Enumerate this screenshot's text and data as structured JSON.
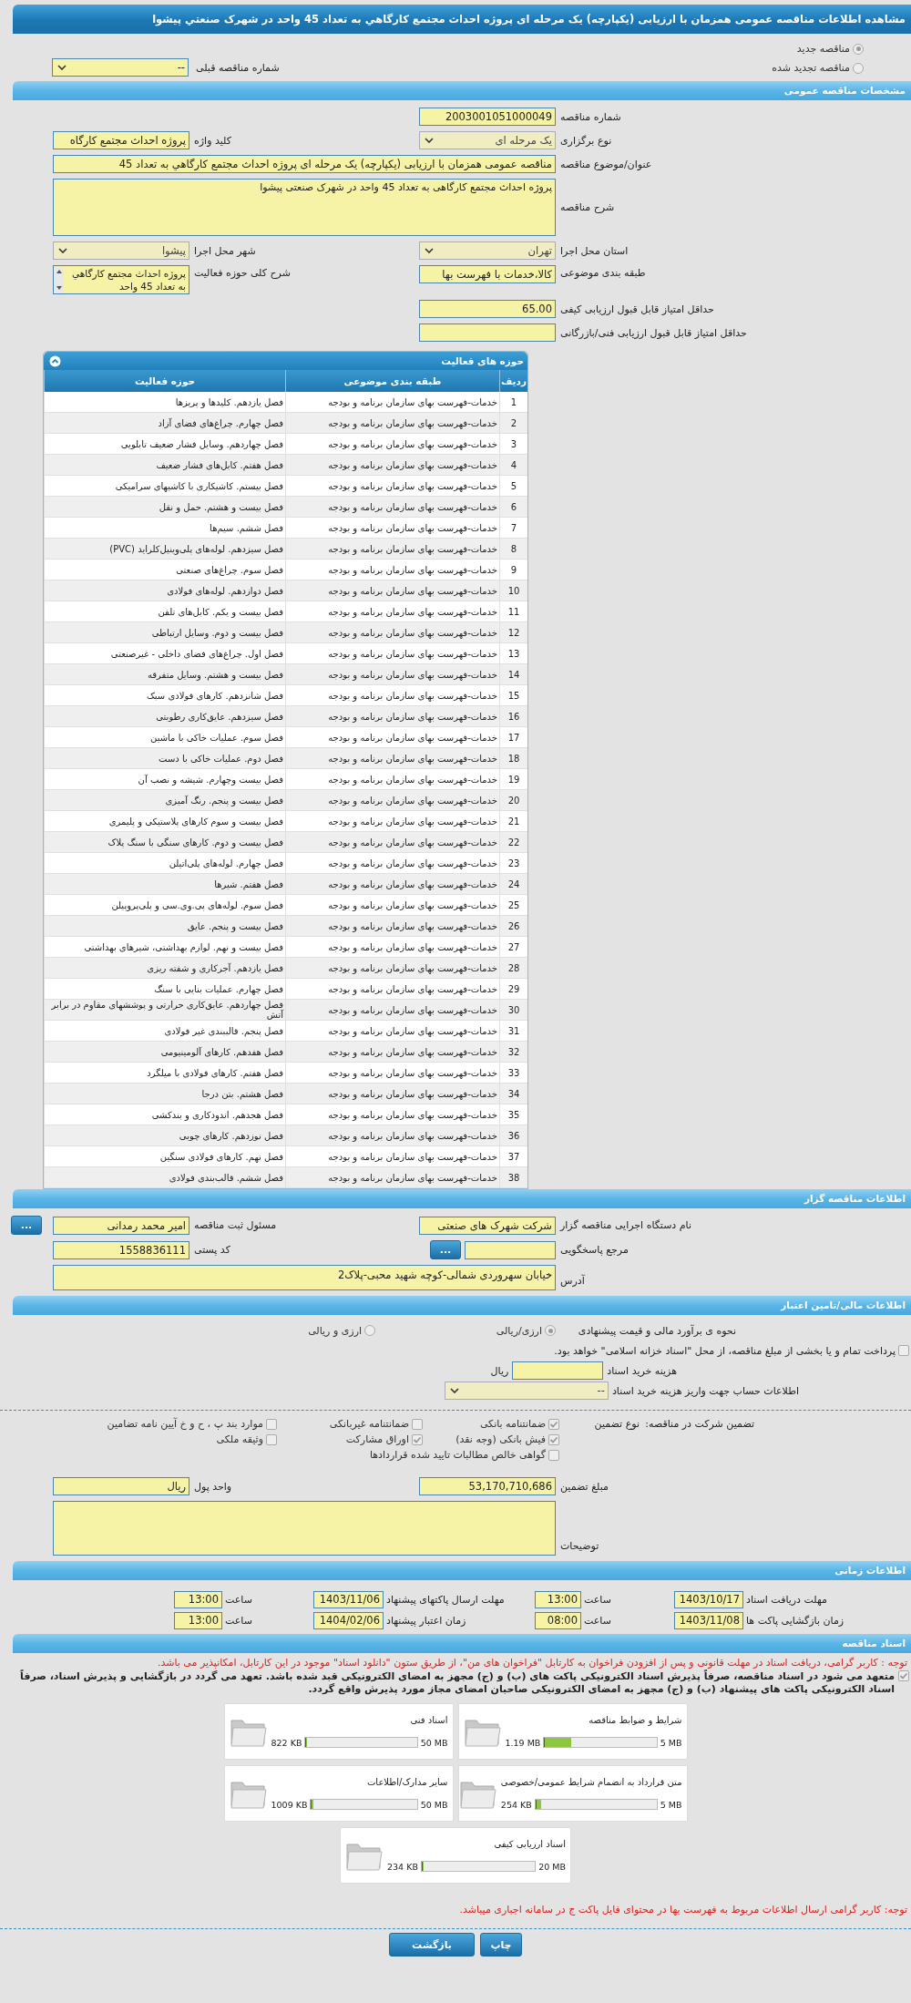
{
  "page_title": "مشاهده اطلاعات مناقصه عمومی همزمان با ارزیابی (یکپارچه) یک مرحله ای پروژه احداث مجتمع کارگاهي به تعداد 45 واحد در شهرک صنعتي پيشوا",
  "tender_types": [
    {
      "label": "مناقصه جدید",
      "selected": true
    },
    {
      "label": "مناقصه تجدید شده",
      "selected": false
    }
  ],
  "previous_tender": {
    "label": "شماره مناقصه قبلی",
    "value": "--"
  },
  "general": {
    "title": "مشخصات مناقصه عمومی",
    "tender_number": {
      "label": "شماره مناقصه",
      "value": "2003001051000049"
    },
    "holding_type": {
      "label": "نوع برگزاری",
      "value": "یک مرحله ای"
    },
    "keyword": {
      "label": "کلید واژه",
      "value": "پروژه احداث مجتمع کارگاه"
    },
    "subject": {
      "label": "عنوان/موضوع مناقصه",
      "value": "مناقصه عمومی همزمان با ارزیابی (یکپارچه) یک مرحله ای پروژه احداث مجتمع کارگاهي به تعداد 45"
    },
    "description": {
      "label": "شرح مناقصه",
      "value": "پروژه احداث مجتمع کارگاهی به تعداد 45 واحد در شهرک صنعتی پیشوا"
    },
    "province": {
      "label": "استان محل اجرا",
      "value": "تهران"
    },
    "city": {
      "label": "شهر محل اجرا",
      "value": "پیشوا"
    },
    "category": {
      "label": "طبقه بندی موضوعی",
      "value": "کالا،خدمات با فهرست بها"
    },
    "activity_summary": {
      "label": "شرح کلی حوزه فعالیت",
      "value": "پروژه احداث مجتمع کارگاهي به تعداد 45 واحد"
    },
    "min_quality_score": {
      "label": "حداقل امتیاز قابل قبول ارزیابی کیفی",
      "value": "65.00"
    },
    "min_technical_score": {
      "label": "حداقل امتیاز قابل قبول ارزیابی فنی/بازرگانی"
    }
  },
  "activity_table": {
    "title": "حوزه های فعالیت",
    "columns": [
      "ردیف",
      "طبقه بندی موضوعی",
      "حوزه فعالیت"
    ],
    "rows": [
      [
        "1",
        "خدمات-فهرست بهای سازمان برنامه و بودجه",
        "فصل یازدهم. کلیدها و پریزها"
      ],
      [
        "2",
        "خدمات-فهرست بهای سازمان برنامه و بودجه",
        "فصل چهارم. چراغ‌های فضای آزاد"
      ],
      [
        "3",
        "خدمات-فهرست بهای سازمان برنامه و بودجه",
        "فصل چهاردهم. وسایل فشار ضعیف تابلویی"
      ],
      [
        "4",
        "خدمات-فهرست بهای سازمان برنامه و بودجه",
        "فصل هفتم. کابل‌های فشار ضعیف"
      ],
      [
        "5",
        "خدمات-فهرست بهای سازمان برنامه و بودجه",
        "فصل بیستم. کاشیکاری با کاشیهای سرامیکی"
      ],
      [
        "6",
        "خدمات-فهرست بهای سازمان برنامه و بودجه",
        "فصل بیست و هشتم. حمل و نقل"
      ],
      [
        "7",
        "خدمات-فهرست بهای سازمان برنامه و بودجه",
        "فصل ششم. سیم‌ها"
      ],
      [
        "8",
        "خدمات-فهرست بهای سازمان برنامه و بودجه",
        "فصل سیزدهم. لوله‌های پلی‌وینیل‌کلراید (PVC)"
      ],
      [
        "9",
        "خدمات-فهرست بهای سازمان برنامه و بودجه",
        "فصل سوم. چراغ‌های صنعتی"
      ],
      [
        "10",
        "خدمات-فهرست بهای سازمان برنامه و بودجه",
        "فصل دوازدهم. لوله‌های فولادی"
      ],
      [
        "11",
        "خدمات-فهرست بهای سازمان برنامه و بودجه",
        "فصل بیست و یکم. کابل‌های تلفن"
      ],
      [
        "12",
        "خدمات-فهرست بهای سازمان برنامه و بودجه",
        "فصل بیست و دوم. وسایل ارتباطی"
      ],
      [
        "13",
        "خدمات-فهرست بهای سازمان برنامه و بودجه",
        "فصل اول. چراغ‌های فضای داخلی - غیرصنعتی"
      ],
      [
        "14",
        "خدمات-فهرست بهای سازمان برنامه و بودجه",
        "فصل بیست و هشتم. وسایل متفرقه"
      ],
      [
        "15",
        "خدمات-فهرست بهای سازمان برنامه و بودجه",
        "فصل شانزدهم. کارهای فولادی سبک"
      ],
      [
        "16",
        "خدمات-فهرست بهای سازمان برنامه و بودجه",
        "فصل سیزدهم. عایق‌کاری رطوبتی"
      ],
      [
        "17",
        "خدمات-فهرست بهای سازمان برنامه و بودجه",
        "فصل سوم. عملیات خاکی با ماشین"
      ],
      [
        "18",
        "خدمات-فهرست بهای سازمان برنامه و بودجه",
        "فصل دوم. عملیات خاکی با دست"
      ],
      [
        "19",
        "خدمات-فهرست بهای سازمان برنامه و بودجه",
        "فصل بیست وچهارم. شیشه و نصب آن"
      ],
      [
        "20",
        "خدمات-فهرست بهای سازمان برنامه و بودجه",
        "فصل بیست و پنجم. رنگ آمیزی"
      ],
      [
        "21",
        "خدمات-فهرست بهای سازمان برنامه و بودجه",
        "فصل بیست و سوم کارهای پلاستیکی و پلیمری"
      ],
      [
        "22",
        "خدمات-فهرست بهای سازمان برنامه و بودجه",
        "فصل بیست و دوم. کارهای سنگی با سنگ پلاک"
      ],
      [
        "23",
        "خدمات-فهرست بهای سازمان برنامه و بودجه",
        "فصل چهارم. لوله‌های پلی‌اتیلن"
      ],
      [
        "24",
        "خدمات-فهرست بهای سازمان برنامه و بودجه",
        "فصل هفتم. شیرها"
      ],
      [
        "25",
        "خدمات-فهرست بهای سازمان برنامه و بودجه",
        "فصل سوم. لوله‌های پی.وی.سی و پلی‌پروپیلن"
      ],
      [
        "26",
        "خدمات-فهرست بهای سازمان برنامه و بودجه",
        "فصل بیست و پنجم. عایق"
      ],
      [
        "27",
        "خدمات-فهرست بهای سازمان برنامه و بودجه",
        "فصل بیست و نهم. لوازم بهداشتی، شیرهای بهداشتی"
      ],
      [
        "28",
        "خدمات-فهرست بهای سازمان برنامه و بودجه",
        "فصل یازدهم. آجرکاری و شفته ریزی"
      ],
      [
        "29",
        "خدمات-فهرست بهای سازمان برنامه و بودجه",
        "فصل چهارم. عملیات بنایی با سنگ"
      ],
      [
        "30",
        "خدمات-فهرست بهای سازمان برنامه و بودجه",
        "فصل چهاردهم. عایق‌کاری حرارتی و پوششهای مقاوم در برابر آتش"
      ],
      [
        "31",
        "خدمات-فهرست بهای سازمان برنامه و بودجه",
        "فصل پنجم. قالببندی غیر فولادی"
      ],
      [
        "32",
        "خدمات-فهرست بهای سازمان برنامه و بودجه",
        "فصل هفدهم. کارهای آلومینیومی"
      ],
      [
        "33",
        "خدمات-فهرست بهای سازمان برنامه و بودجه",
        "فصل هفتم. کارهای فولادی با میلگرد"
      ],
      [
        "34",
        "خدمات-فهرست بهای سازمان برنامه و بودجه",
        "فصل هشتم. بتن درجا"
      ],
      [
        "35",
        "خدمات-فهرست بهای سازمان برنامه و بودجه",
        "فصل هجدهم. اندودکاری و بندکشی"
      ],
      [
        "36",
        "خدمات-فهرست بهای سازمان برنامه و بودجه",
        "فصل نوزدهم. کارهای چوبی"
      ],
      [
        "37",
        "خدمات-فهرست بهای سازمان برنامه و بودجه",
        "فصل نهم. کارهای فولادی سنگین"
      ],
      [
        "38",
        "خدمات-فهرست بهای سازمان برنامه و بودجه",
        "فصل ششم. قالب‌بندی فولادی"
      ]
    ]
  },
  "organizer": {
    "title": "اطلاعات مناقصه گزار",
    "agency": {
      "label": "نام دستگاه اجرایی مناقصه گزار",
      "value": "شرکت شهرک های صنعتی"
    },
    "registrar": {
      "label": "مسئول ثبت مناقصه",
      "value": "امیر محمد  رمدانی",
      "button": "..."
    },
    "reference": {
      "label": "مرجع پاسخگویی",
      "button": "..."
    },
    "postal_code": {
      "label": "کد پستی",
      "value": "1558836111"
    },
    "address": {
      "label": "آدرس",
      "value": "خیابان سهروردی شمالی-کوچه شهید محبی-پلاک2"
    }
  },
  "finance": {
    "title": "اطلاعات مالی/تامین اعتبار",
    "estimate_label": "نحوه ی برآورد مالی و قیمت پیشنهادی",
    "estimate_options": [
      {
        "label": "ارزی/ریالی",
        "selected": true
      },
      {
        "label": "ارزی و ریالی",
        "selected": false
      }
    ],
    "treasury": {
      "label": "پرداخت تمام و یا بخشی از مبلغ مناقصه، از محل \"اسناد خزانه اسلامی\" خواهد بود.",
      "checked": false
    },
    "doc_fee": {
      "label": "هزینه خرید اسناد",
      "unit": "ریال"
    },
    "account": {
      "label": "اطلاعات حساب جهت واریز هزینه خرید اسناد",
      "value": "--"
    },
    "guarantee_label": "تضمین شرکت در مناقصه:",
    "guarantee_type_label": "نوع تضمین",
    "guarantee_types": [
      {
        "label": "ضمانتنامه بانکی",
        "checked": true
      },
      {
        "label": "ضمانتنامه غیربانکی",
        "checked": false
      },
      {
        "label": "موارد بند پ ، ح و خ آیین نامه تضامین",
        "checked": false
      },
      {
        "label": "فیش بانکی (وجه نقد)",
        "checked": true
      },
      {
        "label": "اوراق مشارکت",
        "checked": true
      },
      {
        "label": "وثیقه ملکی",
        "checked": false
      },
      {
        "label": "گواهی خالص مطالبات تایید شده قراردادها",
        "checked": false
      }
    ],
    "amount": {
      "label": "مبلغ تضمین",
      "value": "53,170,710,686"
    },
    "currency": {
      "label": "واحد پول",
      "value": "ریال"
    },
    "notes": {
      "label": "توضیحات"
    }
  },
  "timing": {
    "title": "اطلاعات زمانی",
    "items": [
      {
        "label": "مهلت دریافت اسناد",
        "date": "1403/10/17",
        "time_label": "ساعت",
        "time": "13:00"
      },
      {
        "label": "مهلت ارسال پاکتهای پیشنهاد",
        "date": "1403/11/06",
        "time_label": "ساعت",
        "time": "13:00"
      },
      {
        "label": "زمان بازگشایی پاکت ها",
        "date": "1403/11/08",
        "time_label": "ساعت",
        "time": "08:00"
      },
      {
        "label": "زمان اعتبار پیشنهاد",
        "date": "1404/02/06",
        "time_label": "ساعت",
        "time": "13:00"
      }
    ]
  },
  "documents": {
    "title": "اسناد مناقصه",
    "notice": "توجه : کاربر گرامی، دریافت اسناد در مهلت قانونی و پس از افزودن فراخوان به کارتابل \"فراخوان های من\"، از طریق ستون \"دانلود اسناد\" موجود در این کارتابل، امکانپذیر می باشد.",
    "commitment": {
      "text": "متعهد می شود در اسناد مناقصه، صرفاً پذیرش اسناد الکترونیکی پاکت های (ب) و (ج) مجهز به امضای الکترونیکی قبد شده باشد. تعهد می گردد در بازگشایی و پذیرش اسناد، صرفاً اسناد الکترونیکی پاکت های پیشنهاد (ب) و (ج) مجهز به امضای الکترونیکی صاحبان امضای مجاز مورد پذیرش واقع گردد.",
      "checked": true
    },
    "files": [
      {
        "name": "شرایط و ضوابط مناقصه",
        "used": "1.19 MB",
        "limit": "5 MB",
        "level": 0.24
      },
      {
        "name": "اسناد فنی",
        "used": "822 KB",
        "limit": "50 MB",
        "level": 0.016
      },
      {
        "name": "متن قرارداد به انضمام شرایط عمومی/خصوصی",
        "used": "254 KB",
        "limit": "5 MB",
        "level": 0.05
      },
      {
        "name": "سایر مدارک/اطلاعات",
        "used": "1009 KB",
        "limit": "50 MB",
        "level": 0.02
      },
      {
        "name": "اسناد ارزیابی کیفی",
        "used": "234 KB",
        "limit": "20 MB",
        "level": 0.011
      }
    ],
    "footer_notice": "توجه: کاربر گرامی ارسال اطلاعات مربوط به فهرست بها در محتوای فایل پاکت ج در سامانه اجباری میباشد."
  },
  "buttons": [
    {
      "label": "چاپ"
    },
    {
      "label": "بازگشت"
    }
  ]
}
